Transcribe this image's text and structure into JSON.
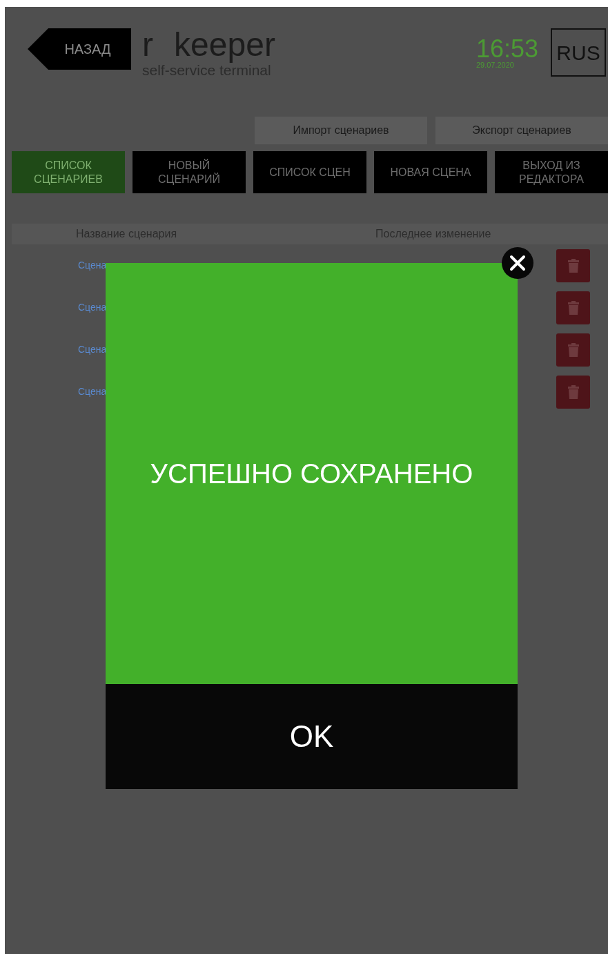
{
  "header": {
    "back_button": "НАЗАД",
    "logo": {
      "title": "r keeper",
      "subtitle": "self-service terminal"
    },
    "time": "16:53",
    "date": "29.07.2020",
    "language_button": "RUS"
  },
  "tool_buttons": [
    "Импорт сценариев",
    "Экспорт сценариев"
  ],
  "nav_tabs": [
    {
      "label": "СПИСОК СЦЕНАРИЕВ",
      "selected": true
    },
    {
      "label": "НОВЫЙ СЦЕНАРИЙ",
      "selected": false
    },
    {
      "label": "СПИСОК СЦЕН",
      "selected": false
    },
    {
      "label": "НОВАЯ СЦЕНА",
      "selected": false
    },
    {
      "label": "ВЫХОД ИЗ РЕДАКТОРА",
      "selected": false
    }
  ],
  "table": {
    "columns": [
      "Название сценария",
      "Последнее изменение"
    ],
    "rows": [
      {
        "name": "Сцена"
      },
      {
        "name": "Сцена"
      },
      {
        "name": "Сцена"
      },
      {
        "name": "Сцена"
      }
    ]
  },
  "dialog": {
    "message": "УСПЕШНО СОХРАНЕНО",
    "ok_button": "OK"
  }
}
